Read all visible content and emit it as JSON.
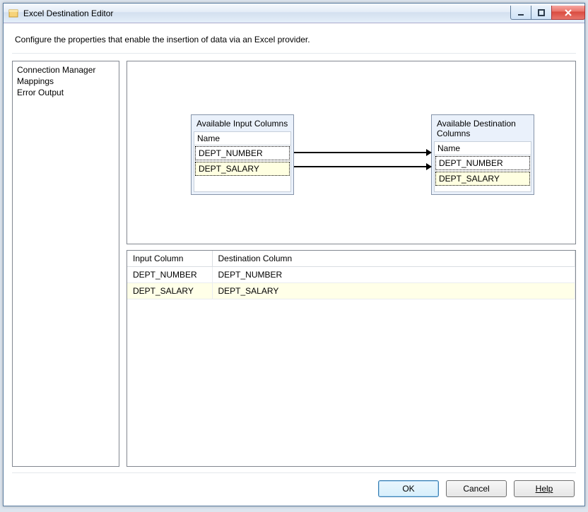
{
  "window": {
    "title": "Excel Destination Editor"
  },
  "description": "Configure the properties that enable the insertion of data via an Excel provider.",
  "nav": {
    "items": [
      {
        "label": "Connection Manager"
      },
      {
        "label": "Mappings"
      },
      {
        "label": "Error Output"
      }
    ]
  },
  "mapping": {
    "inputBox": {
      "title": "Available Input Columns",
      "header": "Name",
      "rows": [
        "DEPT_NUMBER",
        "DEPT_SALARY"
      ]
    },
    "destBox": {
      "title": "Available Destination Columns",
      "header": "Name",
      "rows": [
        "DEPT_NUMBER",
        "DEPT_SALARY"
      ]
    }
  },
  "grid": {
    "headers": {
      "col1": "Input Column",
      "col2": "Destination Column"
    },
    "rows": [
      {
        "input": "DEPT_NUMBER",
        "dest": "DEPT_NUMBER"
      },
      {
        "input": "DEPT_SALARY",
        "dest": "DEPT_SALARY"
      }
    ]
  },
  "buttons": {
    "ok": "OK",
    "cancel": "Cancel",
    "help": "Help"
  }
}
